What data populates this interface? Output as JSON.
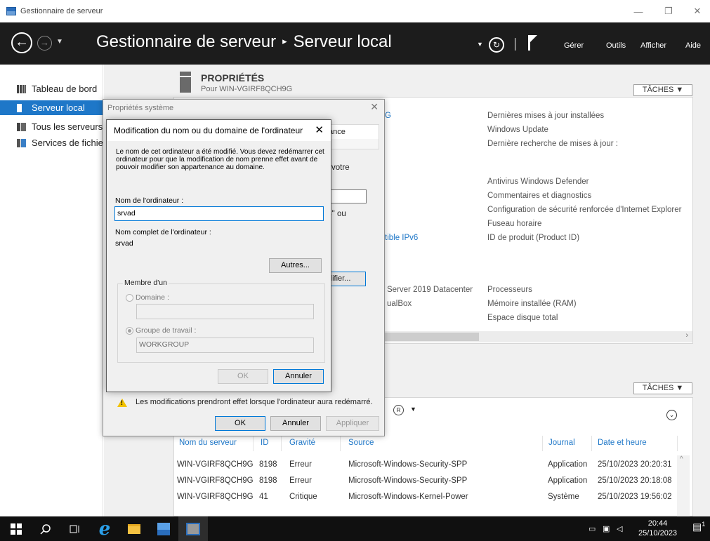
{
  "window": {
    "title": "Gestionnaire de serveur",
    "controls": [
      "—",
      "❐",
      "✕"
    ]
  },
  "header": {
    "app_name": "Gestionnaire de serveur",
    "separator": "▸",
    "page": "Serveur local",
    "menu": [
      "Gérer",
      "Outils",
      "Afficher",
      "Aide"
    ]
  },
  "sidebar": {
    "items": [
      {
        "label": "Tableau de bord",
        "icon": "dashboard-icon"
      },
      {
        "label": "Serveur local",
        "icon": "server-icon",
        "active": true
      },
      {
        "label": "Tous les serveurs",
        "icon": "servers-icon"
      },
      {
        "label": "Services de fichiers",
        "icon": "file-services-icon"
      }
    ]
  },
  "properties": {
    "title": "PROPRIÉTÉS",
    "subtitle": "Pour WIN-VGIRF8QCH9G",
    "tasks_label": "TÂCHES ▼",
    "fragment_6": "G",
    "right_col1": [
      "Dernières mises à jour installées",
      "Windows Update",
      "Dernière recherche de mises à jour :"
    ],
    "right_col2": [
      "Antivirus Windows Defender",
      "Commentaires et diagnostics",
      "Configuration de sécurité renforcée d'Internet Explorer",
      "Fuseau horaire",
      "ID de produit (Product ID)"
    ],
    "ipv6_fragment": "tible IPv6",
    "os_fragment": "Server 2019 Datacenter",
    "vb_fragment": "ualBox",
    "right_col3": [
      "Processeurs",
      "Mémoire installée (RAM)",
      "Espace disque total"
    ]
  },
  "events": {
    "tasks_label": "TÂCHES ▼",
    "columns": [
      "Nom du serveur",
      "ID",
      "Gravité",
      "Source",
      "Journal",
      "Date et heure"
    ],
    "rows": [
      [
        "WIN-VGIRF8QCH9G",
        "8198",
        "Erreur",
        "Microsoft-Windows-Security-SPP",
        "Application",
        "25/10/2023 20:20:31"
      ],
      [
        "WIN-VGIRF8QCH9G",
        "8198",
        "Erreur",
        "Microsoft-Windows-Security-SPP",
        "Application",
        "25/10/2023 20:18:08"
      ],
      [
        "WIN-VGIRF8QCH9G",
        "41",
        "Critique",
        "Microsoft-Windows-Kernel-Power",
        "Système",
        "25/10/2023 19:56:02"
      ]
    ]
  },
  "sysprops": {
    "title": "Propriétés système",
    "tab_fragment": "tance",
    "frag_votre": "r votre",
    "frag_ou": "S\" ou",
    "frag_modifier": "difier...",
    "warning": "Les modifications prendront effet lorsque l'ordinateur aura redémarré.",
    "ok": "OK",
    "cancel": "Annuler",
    "apply": "Appliquer"
  },
  "rename": {
    "title": "Modification du nom ou du domaine de l'ordinateur",
    "info": "Le nom de cet ordinateur a été modifié. Vous devez redémarrer cet ordinateur pour que la modification de nom prenne effet avant de pouvoir modifier son appartenance au domaine.",
    "computer_name_label": "Nom de l'ordinateur :",
    "computer_name_value": "srvad",
    "full_name_label": "Nom complet de l'ordinateur :",
    "full_name_value": "srvad",
    "other_button": "Autres...",
    "member_of": "Membre d'un",
    "domain_label": "Domaine :",
    "domain_value": "",
    "workgroup_label": "Groupe de travail :",
    "workgroup_value": "WORKGROUP",
    "ok": "OK",
    "cancel": "Annuler"
  },
  "taskbar": {
    "time": "20:44",
    "date": "25/10/2023",
    "notification_count": "1"
  }
}
